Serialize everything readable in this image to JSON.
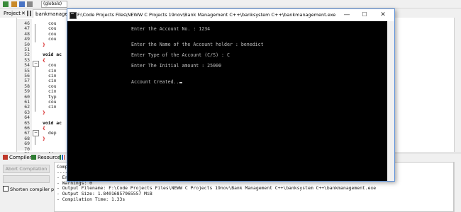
{
  "toolbar": {
    "globals_value": "(globals)"
  },
  "tabs": {
    "project": "Project",
    "file": "bankmanagement"
  },
  "editor": {
    "lines": [
      {
        "num": "46",
        "code": "cou"
      },
      {
        "num": "47",
        "code": "cou"
      },
      {
        "num": "48",
        "code": "cou"
      },
      {
        "num": "49",
        "code": "cou"
      },
      {
        "num": "50",
        "code": "}"
      },
      {
        "num": "51",
        "code": ""
      },
      {
        "num": "52",
        "code": "void ac"
      },
      {
        "num": "53",
        "code": "{"
      },
      {
        "num": "54",
        "code": "cou"
      },
      {
        "num": "55",
        "code": "cin"
      },
      {
        "num": "56",
        "code": "cin"
      },
      {
        "num": "57",
        "code": "cin"
      },
      {
        "num": "58",
        "code": "cou"
      },
      {
        "num": "59",
        "code": "cin"
      },
      {
        "num": "60",
        "code": "typ"
      },
      {
        "num": "61",
        "code": "cou"
      },
      {
        "num": "62",
        "code": "cin"
      },
      {
        "num": "63",
        "code": "}"
      },
      {
        "num": "64",
        "code": ""
      },
      {
        "num": "65",
        "code": "void ac"
      },
      {
        "num": "66",
        "code": "{"
      },
      {
        "num": "67",
        "code": "dep"
      },
      {
        "num": "68",
        "code": "}"
      },
      {
        "num": "69",
        "code": ""
      },
      {
        "num": "70",
        "code": ""
      },
      {
        "num": "71",
        "code": "void ac"
      }
    ]
  },
  "bottom": {
    "tab_compiler": "Compiler",
    "tab_resources": "Resources",
    "abort_label": "Abort Compilation",
    "shorten_label": "Shorten compiler paths",
    "log_lines": [
      "Comp",
      "----",
      "- Er",
      "- Warnings: 0",
      "- Output Filename: F:\\Code Projects Files\\NEWW C Projects 19nov\\Bank Management C++\\banksystem C++\\bankmanagement.exe",
      "- Output Size: 1.84016857965557 MiB",
      "- Compilation Time: 1.33s"
    ]
  },
  "console": {
    "title": "F:\\Code Projects Files\\NEWW C Projects 19nov\\Bank Management C++\\banksystem C++\\bankmanagement.exe",
    "btn_min": "—",
    "btn_max": "☐",
    "btn_close": "✕",
    "line_account_no": "Enter the Account No. : 1234",
    "line_holder": "Enter the Name of the Account holder : benedict",
    "line_type": "Enter Type of the Account (C/S) : C",
    "line_amount": "Enter The Initial amount : 25000",
    "line_created": "Account Created.."
  },
  "colors": {
    "console_bg": "#000000",
    "console_text": "#c0c0c0",
    "brace": "#d00000",
    "window_border": "#5a8fd8"
  }
}
